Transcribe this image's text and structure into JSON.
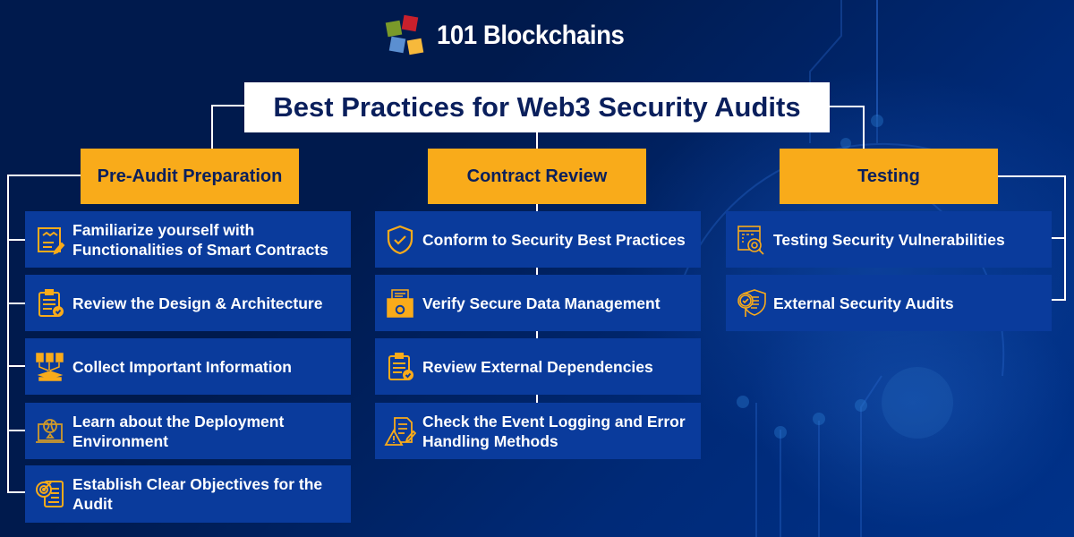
{
  "brand": {
    "name": "101 Blockchains",
    "logo_colors": [
      "#7a9a2a",
      "#c8202c",
      "#5b8fd1",
      "#f7b93b"
    ]
  },
  "title": "Best Practices for Web3 Security Audits",
  "colors": {
    "background": "#001a4d",
    "category_fill": "#f9ab1a",
    "category_text": "#0a1f5c",
    "item_fill": "#0a3b9c",
    "item_text": "#ffffff",
    "icon": "#f9ab1a",
    "connector": "#ffffff"
  },
  "columns": [
    {
      "heading": "Pre-Audit Preparation",
      "items": [
        {
          "icon": "contract-handshake-icon",
          "label": "Familiarize yourself with Functionalities of Smart Contracts"
        },
        {
          "icon": "clipboard-check-icon",
          "label": "Review the Design & Architecture"
        },
        {
          "icon": "collect-documents-icon",
          "label": "Collect Important Information"
        },
        {
          "icon": "laptop-globe-icon",
          "label": "Learn about the Deployment Environment"
        },
        {
          "icon": "target-document-icon",
          "label": "Establish Clear Objectives for the Audit"
        }
      ]
    },
    {
      "heading": "Contract Review",
      "items": [
        {
          "icon": "shield-check-icon",
          "label": "Conform to Security Best Practices"
        },
        {
          "icon": "folder-gear-icon",
          "label": "Verify Secure Data Management"
        },
        {
          "icon": "clipboard-check-icon",
          "label": "Review External Dependencies"
        },
        {
          "icon": "document-warning-icon",
          "label": "Check the Event Logging and Error Handling Methods"
        }
      ]
    },
    {
      "heading": "Testing",
      "items": [
        {
          "icon": "code-search-icon",
          "label": "Testing Security Vulnerabilities"
        },
        {
          "icon": "shield-magnifier-icon",
          "label": "External Security Audits"
        }
      ]
    }
  ]
}
